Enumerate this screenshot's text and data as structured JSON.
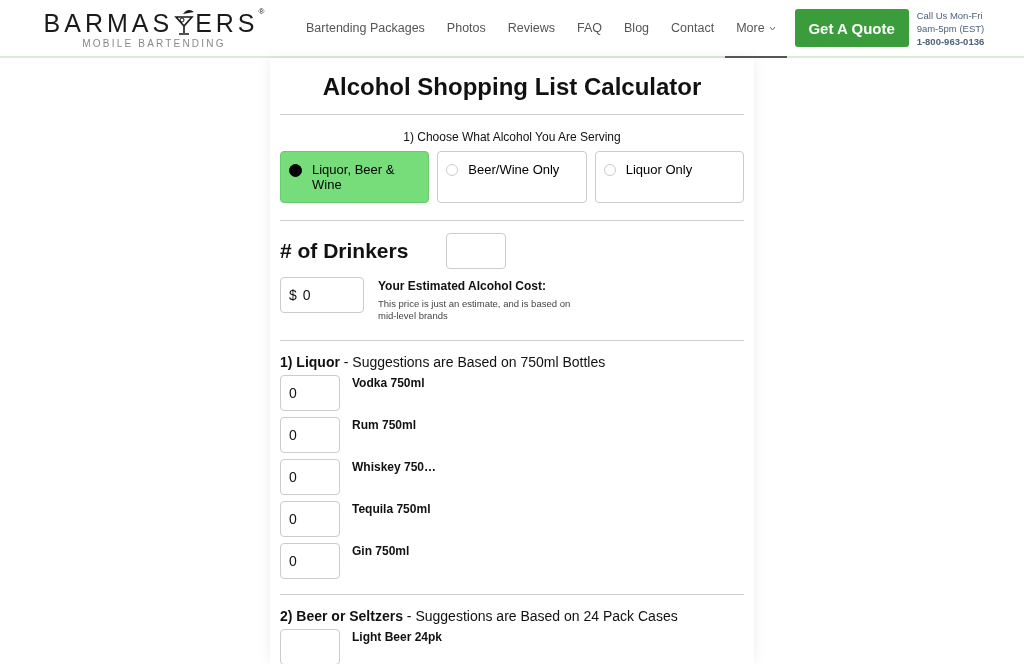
{
  "header": {
    "logo": {
      "left": "BARMAS",
      "right": "ERS",
      "mark": "®",
      "tagline": "MOBILE BARTENDING"
    },
    "nav": [
      {
        "label": "Bartending Packages",
        "selected": false,
        "dropdown": false
      },
      {
        "label": "Photos",
        "selected": false,
        "dropdown": false
      },
      {
        "label": "Reviews",
        "selected": false,
        "dropdown": false
      },
      {
        "label": "FAQ",
        "selected": false,
        "dropdown": false
      },
      {
        "label": "Blog",
        "selected": false,
        "dropdown": false
      },
      {
        "label": "Contact",
        "selected": false,
        "dropdown": false
      },
      {
        "label": "More",
        "selected": true,
        "dropdown": true
      }
    ],
    "cta": "Get A Quote",
    "contact": [
      "Call Us Mon-Fri",
      "9am-5pm (EST)",
      "1-800-963-0136"
    ]
  },
  "calculator": {
    "title": "Alcohol Shopping List Calculator",
    "choice_label": "1) Choose What Alcohol You Are Serving",
    "choices": [
      {
        "label": "Liquor, Beer & Wine",
        "selected": true
      },
      {
        "label": "Beer/Wine Only",
        "selected": false
      },
      {
        "label": "Liquor Only",
        "selected": false
      }
    ],
    "drinkers": {
      "label": "# of Drinkers"
    },
    "cost": {
      "currency": "$",
      "value": "0",
      "label": "Your Estimated Alcohol Cost:",
      "note": "This price is just an estimate, and is based on mid-level brands"
    },
    "sections": [
      {
        "heading": "**1) Liquor** - Suggestions are Based on 750ml Bottles",
        "items": [
          {
            "value": "0",
            "label": "Vodka 750ml"
          },
          {
            "value": "0",
            "label": "Rum 750ml"
          },
          {
            "value": "0",
            "label": "Whiskey 750…"
          },
          {
            "value": "0",
            "label": "Tequila 750ml"
          },
          {
            "value": "0",
            "label": "Gin 750ml"
          }
        ]
      },
      {
        "heading": "**2) Beer or Seltzers** - Suggestions are Based on 24 Pack Cases",
        "items": [
          {
            "value": "",
            "label": "Light Beer 24pk"
          }
        ]
      }
    ]
  }
}
